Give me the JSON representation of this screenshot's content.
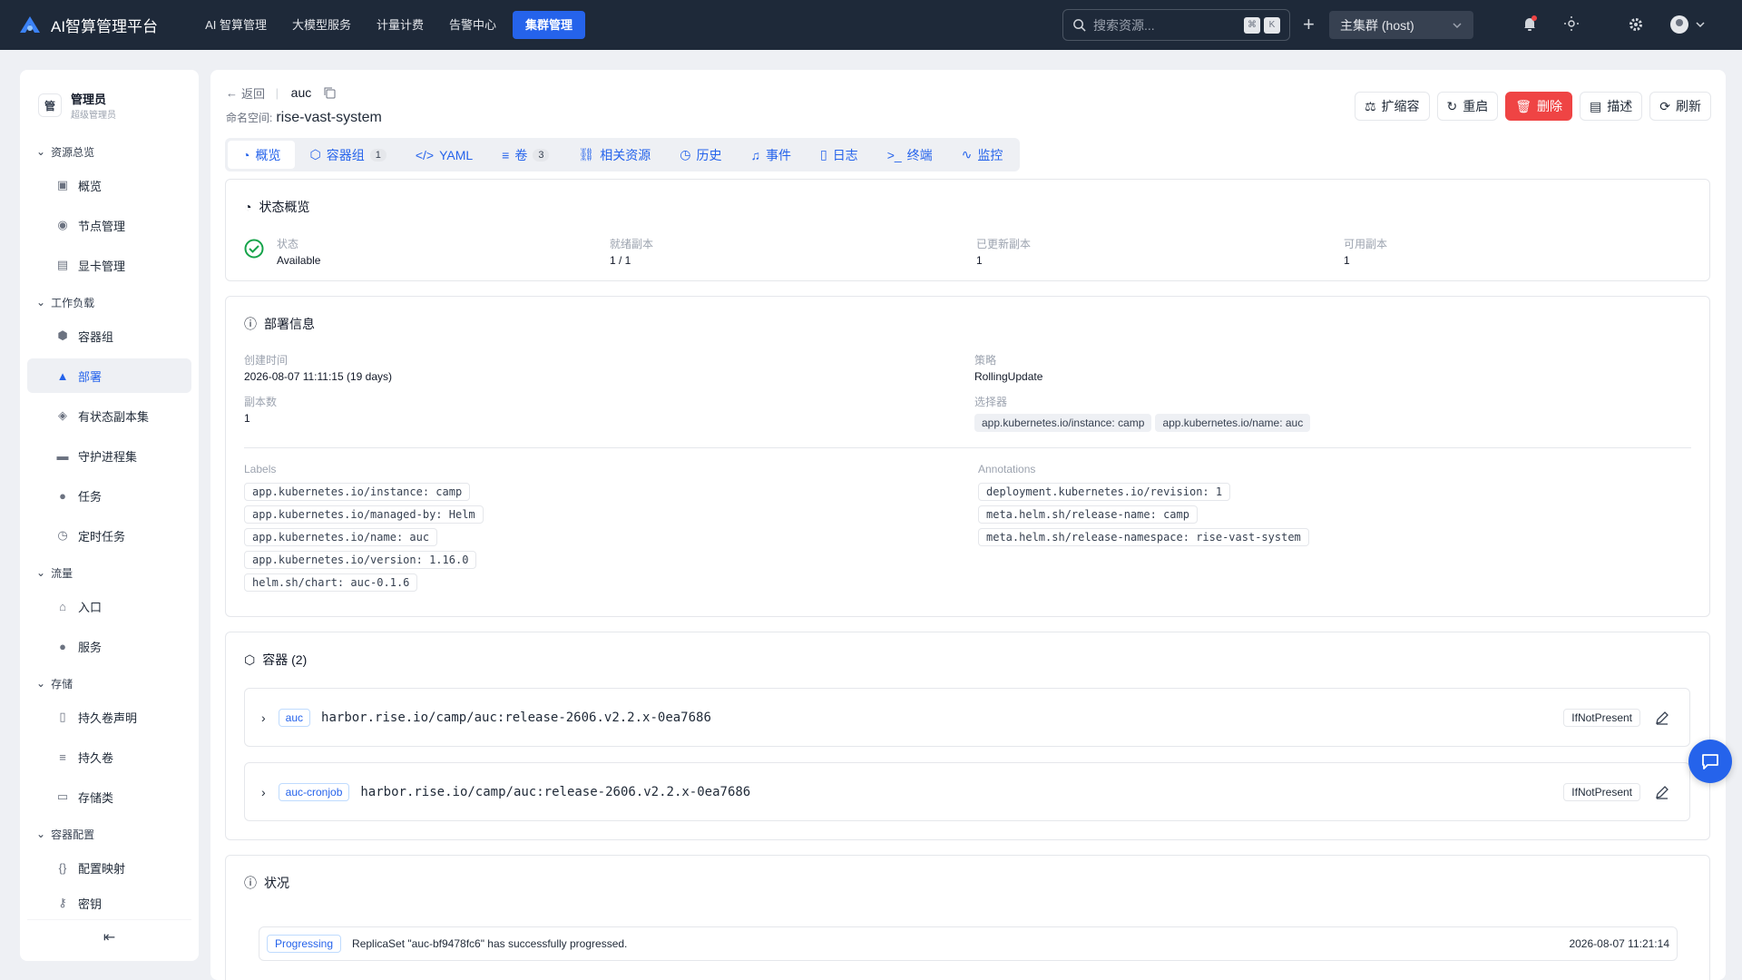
{
  "app": {
    "title": "AI智算管理平台"
  },
  "topnav": [
    "AI 智算管理",
    "大模型服务",
    "计量计费",
    "告警中心",
    "集群管理"
  ],
  "search": {
    "placeholder": "搜索资源...",
    "k1": "⌘",
    "k2": "K"
  },
  "cluster": {
    "value": "主集群 (host)"
  },
  "user": {
    "avatar": "管",
    "name": "管理员",
    "role": "超级管理员"
  },
  "sidebar": {
    "g1": "资源总览",
    "g2": "工作负载",
    "g3": "流量",
    "g4": "存储",
    "g5": "容器配置",
    "items": [
      "概览",
      "节点管理",
      "显卡管理",
      "容器组",
      "部署",
      "有状态副本集",
      "守护进程集",
      "任务",
      "定时任务",
      "入口",
      "服务",
      "持久卷声明",
      "持久卷",
      "存储类",
      "配置映射",
      "密钥"
    ]
  },
  "header": {
    "back": "返回",
    "name": "auc",
    "ns_label": "命名空间:",
    "ns_value": "rise-vast-system"
  },
  "actions": [
    "扩缩容",
    "重启",
    "删除",
    "描述",
    "刷新"
  ],
  "tabs": {
    "overview": "概览",
    "pods": "容器组",
    "pods_count": "1",
    "yaml": "YAML",
    "volumes": "卷",
    "volumes_count": "3",
    "related": "相关资源",
    "history": "历史",
    "events": "事件",
    "logs": "日志",
    "terminal": "终端",
    "monitor": "监控"
  },
  "status": {
    "title": "状态概览",
    "state_label": "状态",
    "state": "Available",
    "ready_label": "就绪副本",
    "ready": "1 / 1",
    "updated_label": "已更新副本",
    "updated": "1",
    "available_label": "可用副本",
    "available": "1"
  },
  "deploy": {
    "title": "部署信息",
    "created_label": "创建时间",
    "created": "2026-08-07 11:11:15 (19 days)",
    "strategy_label": "策略",
    "strategy": "RollingUpdate",
    "replicas_label": "副本数",
    "replicas": "1",
    "selector_label": "选择器",
    "selector": [
      "app.kubernetes.io/instance: camp",
      "app.kubernetes.io/name: auc"
    ],
    "labels_label": "Labels",
    "labels": [
      "app.kubernetes.io/instance: camp",
      "app.kubernetes.io/managed-by: Helm",
      "app.kubernetes.io/name: auc",
      "app.kubernetes.io/version: 1.16.0",
      "helm.sh/chart: auc-0.1.6"
    ],
    "annotations_label": "Annotations",
    "annotations": [
      "deployment.kubernetes.io/revision: 1",
      "meta.helm.sh/release-name: camp",
      "meta.helm.sh/release-namespace: rise-vast-system"
    ]
  },
  "containers": {
    "title": "容器 (2)",
    "list": [
      {
        "name": "auc",
        "image": "harbor.rise.io/camp/auc:release-2606.v2.2.x-0ea7686",
        "pull": "IfNotPresent"
      },
      {
        "name": "auc-cronjob",
        "image": "harbor.rise.io/camp/auc:release-2606.v2.2.x-0ea7686",
        "pull": "IfNotPresent"
      }
    ]
  },
  "conditions": {
    "title": "状况",
    "rows": [
      {
        "type": "Progressing",
        "message": "ReplicaSet \"auc-bf9478fc6\" has successfully progressed.",
        "time": "2026-08-07 11:21:14"
      }
    ]
  }
}
